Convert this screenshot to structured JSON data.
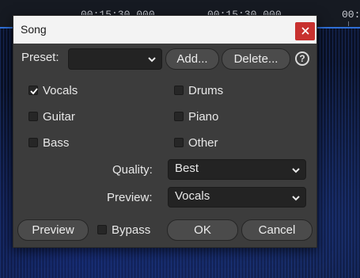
{
  "background": {
    "timeline_labels": [
      "00:15:30.000",
      "00:15:30.000",
      "00:1"
    ],
    "accent": "#2f6fd6"
  },
  "dialog": {
    "title": "Song",
    "close_icon": "close-icon",
    "preset": {
      "label": "Preset:",
      "value": "",
      "add_label": "Add...",
      "delete_label": "Delete...",
      "help_icon": "help-icon"
    },
    "stems": [
      {
        "label": "Vocals",
        "checked": true
      },
      {
        "label": "Drums",
        "checked": false
      },
      {
        "label": "Guitar",
        "checked": false
      },
      {
        "label": "Piano",
        "checked": false
      },
      {
        "label": "Bass",
        "checked": false
      },
      {
        "label": "Other",
        "checked": false
      }
    ],
    "quality": {
      "label": "Quality:",
      "value": "Best"
    },
    "preview_select": {
      "label": "Preview:",
      "value": "Vocals"
    },
    "footer": {
      "preview_button": "Preview",
      "bypass_label": "Bypass",
      "bypass_checked": false,
      "ok_button": "OK",
      "cancel_button": "Cancel"
    },
    "close_color": "#c8312f"
  }
}
